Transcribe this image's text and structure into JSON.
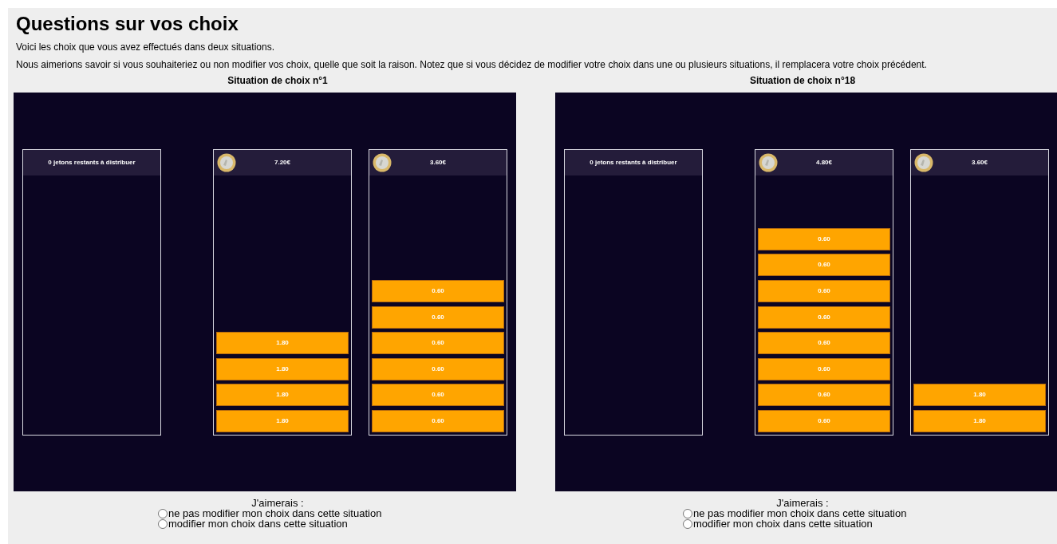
{
  "title": "Questions sur vos choix",
  "paragraphs": [
    "Voici les choix que vous avez effectués dans deux situations.",
    "Nous aimerions savoir si vous souhaiteriez ou non modifier vos choix, quelle que soit la raison. Notez que si vous décidez de modifier votre choix dans une ou plusieurs situations, il remplacera votre choix précédent."
  ],
  "situations": [
    {
      "title": "Situation de choix n°1",
      "remaining": "0 jetons restants à distribuer",
      "columns": [
        {
          "amount": "7.20€",
          "tokens": [
            "1.80",
            "1.80",
            "1.80",
            "1.80"
          ]
        },
        {
          "amount": "3.60€",
          "tokens": [
            "0.60",
            "0.60",
            "0.60",
            "0.60",
            "0.60",
            "0.60"
          ]
        }
      ],
      "prompt": "J'aimerais :",
      "options": [
        {
          "label": "ne pas modifier mon choix dans cette situation",
          "selected": false
        },
        {
          "label": "modifier mon choix dans cette situation",
          "selected": false
        }
      ]
    },
    {
      "title": "Situation de choix n°18",
      "remaining": "0 jetons restants à distribuer",
      "columns": [
        {
          "amount": "4.80€",
          "tokens": [
            "0.60",
            "0.60",
            "0.60",
            "0.60",
            "0.60",
            "0.60",
            "0.60",
            "0.60"
          ]
        },
        {
          "amount": "3.60€",
          "tokens": [
            "1.80",
            "1.80"
          ]
        }
      ],
      "prompt": "J'aimerais :",
      "options": [
        {
          "label": "ne pas modifier mon choix dans cette situation",
          "selected": false
        },
        {
          "label": "modifier mon choix dans cette situation",
          "selected": false
        }
      ]
    }
  ]
}
